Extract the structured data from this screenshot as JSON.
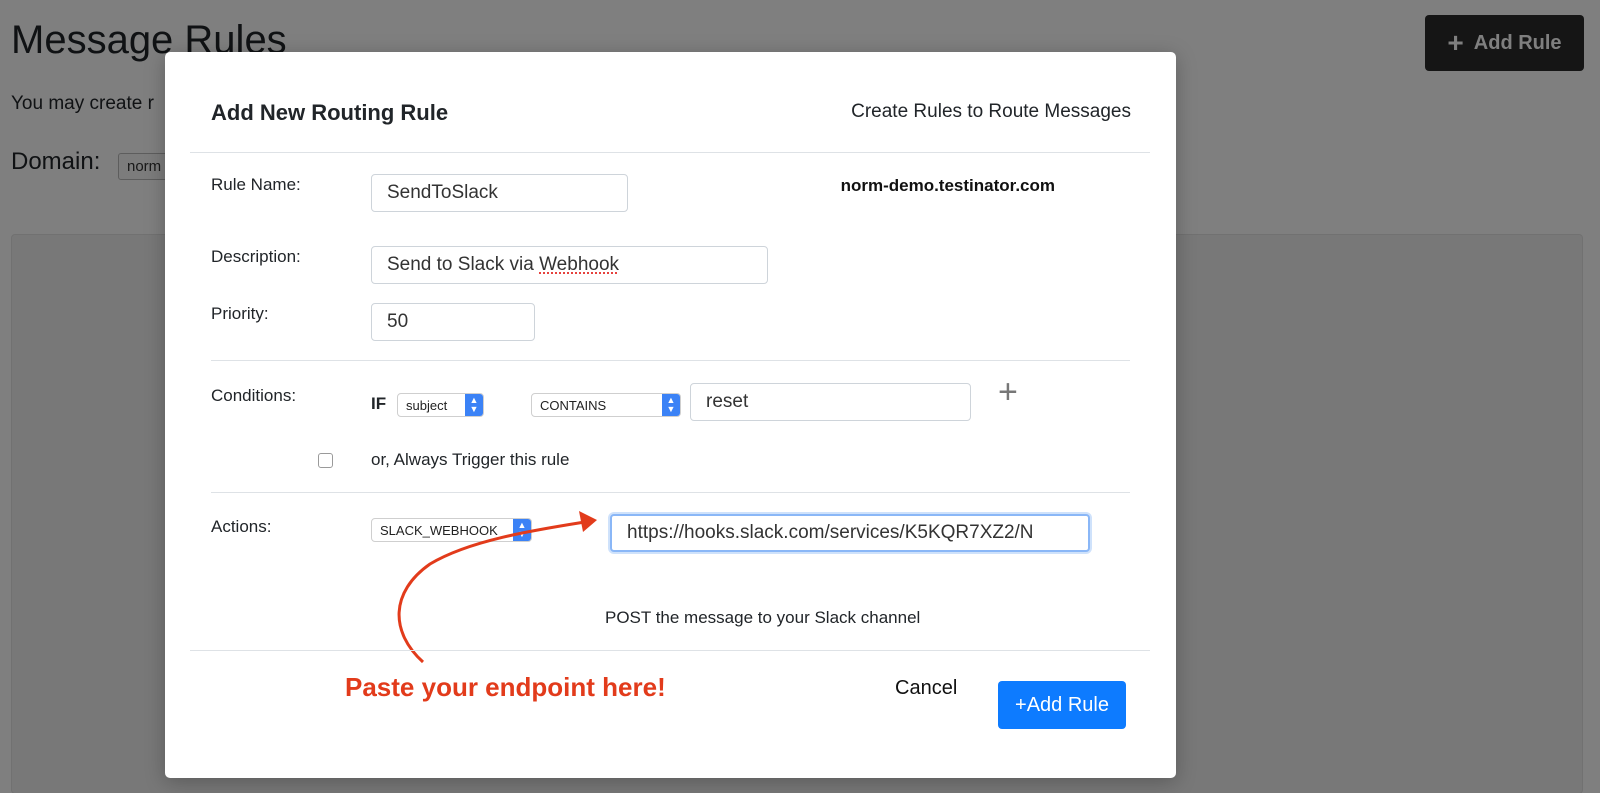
{
  "background": {
    "title": "Message Rules",
    "description": "You may create r",
    "domain_label": "Domain:",
    "domain_value": "norm",
    "add_rule_label": "Add Rule"
  },
  "modal": {
    "title": "Add New Routing Rule",
    "subtitle": "Create Rules to Route Messages",
    "domain": "norm-demo.testinator.com",
    "rule_name": {
      "label": "Rule Name:",
      "value": "SendToSlack"
    },
    "description": {
      "label": "Description:",
      "value_prefix": "Send to Slack via ",
      "value_misspelled": "Webhook"
    },
    "priority": {
      "label": "Priority:",
      "value": "50"
    },
    "conditions": {
      "label": "Conditions:",
      "if_label": "IF",
      "field": "subject",
      "operator": "CONTAINS",
      "value": "reset",
      "always_trigger_label": "or, Always Trigger this rule",
      "always_trigger_checked": false
    },
    "actions": {
      "label": "Actions:",
      "type": "SLACK_WEBHOOK",
      "url": "https://hooks.slack.com/services/K5KQR7XZ2/N",
      "hint": "POST the message to your Slack channel"
    },
    "annotation": "Paste your endpoint here!",
    "cancel_label": "Cancel",
    "submit_label": "+Add Rule"
  },
  "colors": {
    "primary": "#0d7bff",
    "annotation": "#e23b1b",
    "overlay": "rgba(0,0,0,0.5)",
    "dark_button": "#2a2a2a"
  }
}
